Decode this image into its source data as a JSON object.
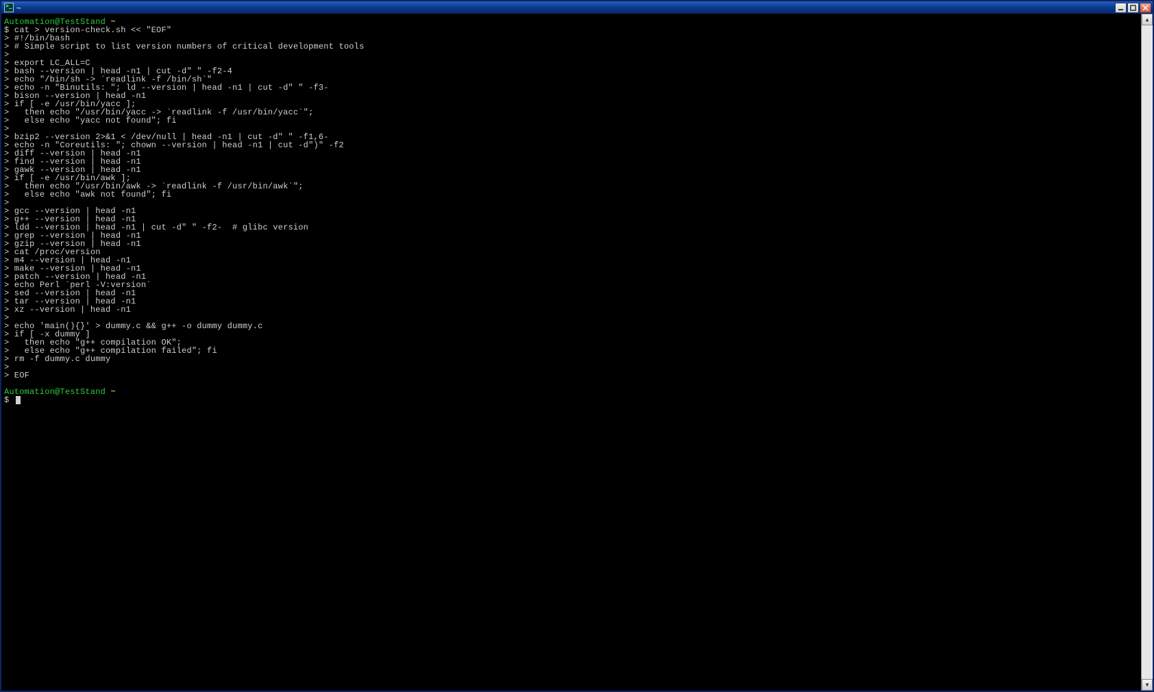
{
  "window": {
    "title": "~",
    "icon_name": "terminal-icon",
    "buttons": {
      "minimize": "_",
      "maximize": "❐",
      "close": "✕"
    }
  },
  "prompt": {
    "user_host": "Automation@TestStand",
    "path": "~",
    "ps1": "$",
    "ps2": ">"
  },
  "first_command": "cat > version-check.sh << \"EOF\"",
  "heredoc_lines": [
    "#!/bin/bash",
    "# Simple script to list version numbers of critical development tools",
    "",
    "export LC_ALL=C",
    "bash --version | head -n1 | cut -d\" \" -f2-4",
    "echo \"/bin/sh -> `readlink -f /bin/sh`\"",
    "echo -n \"Binutils: \"; ld --version | head -n1 | cut -d\" \" -f3-",
    "bison --version | head -n1",
    "if [ -e /usr/bin/yacc ];",
    "  then echo \"/usr/bin/yacc -> `readlink -f /usr/bin/yacc`\";",
    "  else echo \"yacc not found\"; fi",
    "",
    "bzip2 --version 2>&1 < /dev/null | head -n1 | cut -d\" \" -f1,6-",
    "echo -n \"Coreutils: \"; chown --version | head -n1 | cut -d\")\" -f2",
    "diff --version | head -n1",
    "find --version | head -n1",
    "gawk --version | head -n1",
    "if [ -e /usr/bin/awk ];",
    "  then echo \"/usr/bin/awk -> `readlink -f /usr/bin/awk`\";",
    "  else echo \"awk not found\"; fi",
    "",
    "gcc --version | head -n1",
    "g++ --version | head -n1",
    "ldd --version | head -n1 | cut -d\" \" -f2-  # glibc version",
    "grep --version | head -n1",
    "gzip --version | head -n1",
    "cat /proc/version",
    "m4 --version | head -n1",
    "make --version | head -n1",
    "patch --version | head -n1",
    "echo Perl `perl -V:version`",
    "sed --version | head -n1",
    "tar --version | head -n1",
    "xz --version | head -n1",
    "",
    "echo 'main(){}' > dummy.c && g++ -o dummy dummy.c",
    "if [ -x dummy ]",
    "  then echo \"g++ compilation OK\";",
    "  else echo \"g++ compilation failed\"; fi",
    "rm -f dummy.c dummy",
    "",
    "EOF"
  ],
  "scrollbar": {
    "up": "▲",
    "down": "▼"
  }
}
